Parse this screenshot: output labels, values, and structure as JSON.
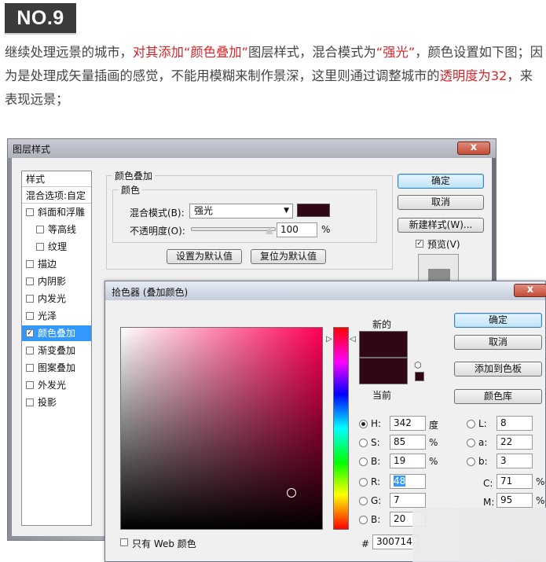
{
  "badge": "NO.9",
  "paragraph": {
    "s1": "继续处理远景的城市，",
    "s2": "对其添加“颜色叠加”",
    "s3": "图层样式，混合模式为",
    "s4": "“强光”",
    "s5": "，颜色设置如下图；因为是处理成矢量插画的感觉，不能用模糊来制作景深，这里则通过调整城市的",
    "s6": "透明度为32",
    "s7": "，来表现远景；"
  },
  "layer_style": {
    "title": "图层样式",
    "styles_header": "样式",
    "blend_options": "混合选项:自定",
    "items": [
      {
        "label": "斜面和浮雕",
        "checked": false,
        "indent": false
      },
      {
        "label": "等高线",
        "checked": false,
        "indent": true
      },
      {
        "label": "纹理",
        "checked": false,
        "indent": true
      },
      {
        "label": "描边",
        "checked": false,
        "indent": false
      },
      {
        "label": "内阴影",
        "checked": false,
        "indent": false
      },
      {
        "label": "内发光",
        "checked": false,
        "indent": false
      },
      {
        "label": "光泽",
        "checked": false,
        "indent": false
      },
      {
        "label": "颜色叠加",
        "checked": true,
        "indent": false
      },
      {
        "label": "渐变叠加",
        "checked": false,
        "indent": false
      },
      {
        "label": "图案叠加",
        "checked": false,
        "indent": false
      },
      {
        "label": "外发光",
        "checked": false,
        "indent": false
      },
      {
        "label": "投影",
        "checked": false,
        "indent": false
      }
    ],
    "group_title": "颜色叠加",
    "subgroup_title": "颜色",
    "blend_mode_label": "混合模式(B):",
    "blend_mode_value": "强光",
    "overlay_color": "#300714",
    "opacity_label": "不透明度(O):",
    "opacity_value": "100",
    "opacity_unit": "%",
    "btn_default": "设置为默认值",
    "btn_reset": "复位为默认值",
    "btn_ok": "确定",
    "btn_cancel": "取消",
    "btn_new_style": "新建样式(W)...",
    "preview_label": "预览(V)",
    "preview_checked": true,
    "close_glyph": "x"
  },
  "color_picker": {
    "title": "拾色器 (叠加颜色)",
    "new_label": "新的",
    "current_label": "当前",
    "new_color": "#300714",
    "current_color": "#300714",
    "btn_ok": "确定",
    "btn_cancel": "取消",
    "btn_add_swatch": "添加到色板",
    "btn_libraries": "颜色库",
    "only_web_label": "只有 Web 颜色",
    "fields": {
      "H": {
        "label": "H:",
        "value": "342",
        "unit": "度"
      },
      "S": {
        "label": "S:",
        "value": "85",
        "unit": "%"
      },
      "Bv": {
        "label": "B:",
        "value": "19",
        "unit": "%"
      },
      "R": {
        "label": "R:",
        "value": "48"
      },
      "G": {
        "label": "G:",
        "value": "7"
      },
      "B2": {
        "label": "B:",
        "value": "20"
      },
      "L": {
        "label": "L:",
        "value": "8"
      },
      "a": {
        "label": "a:",
        "value": "22"
      },
      "b": {
        "label": "b:",
        "value": "3"
      },
      "C": {
        "label": "C:",
        "value": "71",
        "unit": "%"
      },
      "M": {
        "label": "M:",
        "value": "95",
        "unit": "%"
      }
    },
    "hex_label": "#",
    "hex_value": "300714",
    "close_glyph": "x"
  }
}
